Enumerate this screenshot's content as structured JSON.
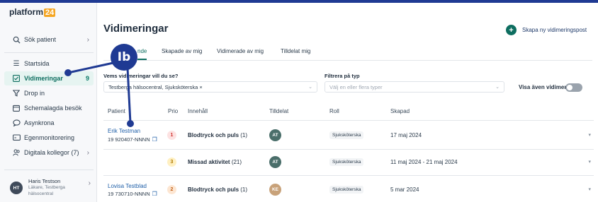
{
  "app": {
    "logo_text": "platform",
    "logo_num": "24"
  },
  "sidebar": {
    "search": "Sök patient",
    "items": [
      {
        "label": "Startsida",
        "icon": "list-icon"
      },
      {
        "label": "Vidimeringar",
        "badge": "9",
        "icon": "checkbox-icon",
        "active": true
      },
      {
        "label": "Drop in",
        "icon": "filter-icon"
      },
      {
        "label": "Schemalagda besök",
        "icon": "calendar-icon"
      },
      {
        "label": "Asynkrona",
        "icon": "chat-icon"
      },
      {
        "label": "Egenmonitorering",
        "icon": "monitor-icon"
      },
      {
        "label": "Digitala kollegor (7)",
        "icon": "people-icon"
      }
    ],
    "user": {
      "initials": "HT",
      "name": "Haris Testson",
      "role": "Läkare, Testberga hälsocentral"
    }
  },
  "main": {
    "title": "Vidimeringar",
    "create_label": "Skapa ny vidimeringspost",
    "tabs": [
      "Att vidimera",
      "Skapade av mig",
      "Vidimerade av mig",
      "Tilldelat mig"
    ],
    "tab_partial": "nde",
    "filter_who_label": "Vems vidimeringar vill du se?",
    "filter_who_value": "Testberga hälsocentral, Sjuksköterska ×",
    "filter_type_label": "Filtrera på typ",
    "filter_type_placeholder": "Välj en eller flera typer",
    "show_done_label": "Visa även vidimerade",
    "columns": [
      "Patient",
      "Prio",
      "Innehåll",
      "Tilldelat",
      "Roll",
      "Skapad"
    ],
    "rows": [
      {
        "name": "Erik Testman",
        "pnr": "19 920407-NNNN",
        "prio": "1",
        "content": "Blodtryck och puls",
        "count": "(1)",
        "assigned": "AT",
        "role": "Sjuksköterska",
        "created": "17 maj 2024"
      },
      {
        "name": "",
        "pnr": "",
        "prio": "3",
        "content": "Missad aktivitet",
        "count": "(21)",
        "assigned": "AT",
        "role": "Sjuksköterska",
        "created": "11 maj 2024 - 21 maj 2024"
      },
      {
        "name": "Lovisa Testblad",
        "pnr": "19 730710-NNNN",
        "prio": "2",
        "content": "Blodtryck och puls",
        "count": "(1)",
        "assigned": "KE",
        "role": "Sjuksköterska",
        "created": "5 mar 2024"
      }
    ]
  },
  "callout": {
    "label": "Ib"
  },
  "colors": {
    "accent": "#0e6e60",
    "callout": "#1f3a93",
    "assign_at": "#4a6e6a",
    "assign_ke": "#c8a27a"
  }
}
